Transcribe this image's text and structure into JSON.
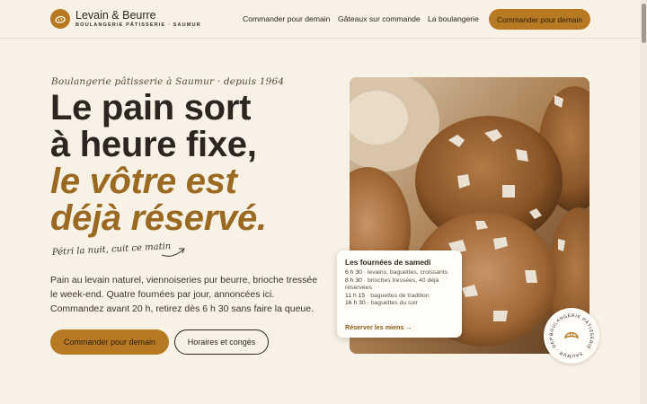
{
  "brand": {
    "name": "Levain & Beurre",
    "tagline": "BOULANGERIE PÂTISSERIE · SAUMUR",
    "logo_icon": "bread-icon"
  },
  "nav": {
    "links": [
      "Commander pour demain",
      "Gâteaux sur commande",
      "La boulangerie"
    ],
    "cta": "Commander pour demain"
  },
  "hero": {
    "eyebrow": "Boulangerie pâtisserie à Saumur · depuis 1964",
    "title_lines": [
      "Le pain sort",
      "à heure fixe,",
      "le vôtre est",
      "déjà réservé."
    ],
    "note": "Pétri la nuit, cuit ce matin",
    "body": "Pain au levain naturel, viennoiseries pur beurre, brioche tressée le week-end. Quatre fournées par jour, annoncées ici. Commandez avant 20 h, retirez dès 6 h 30 sans faire la queue.",
    "primary_cta": "Commander pour demain",
    "secondary_cta": "Horaires et congés"
  },
  "schedule_card": {
    "title": "Les fournées de samedi",
    "rows": [
      {
        "time": "6 h 30",
        "items": "levains, baguettes, croissants"
      },
      {
        "time": "8 h 30",
        "items": "brioches tressées, 40 déjà réservées"
      },
      {
        "time": "11 h 15",
        "items": "baguettes de tradition"
      },
      {
        "time": "16 h 30",
        "items": "baguettes du soir"
      }
    ],
    "link": "Réserver les miens →"
  },
  "badge": {
    "text": "BOULANGERIE PÂTISSERIE · SAUMUR · DEPUIS 1964 ·",
    "icon": "croissant-icon"
  },
  "colors": {
    "background": "#f8f1e6",
    "accent": "#b77a22",
    "accent_text": "#9b6a22",
    "ink": "#2b2620"
  }
}
